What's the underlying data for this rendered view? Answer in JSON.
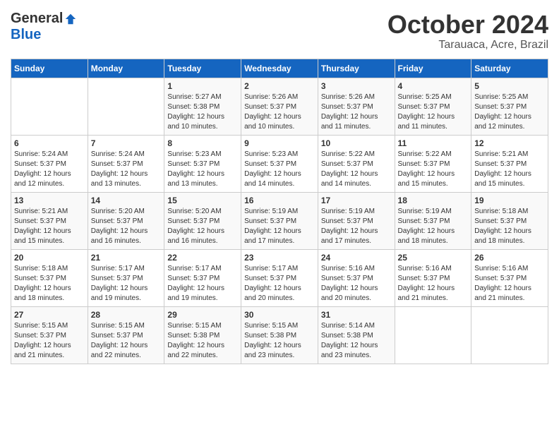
{
  "logo": {
    "general": "General",
    "blue": "Blue"
  },
  "header": {
    "month": "October 2024",
    "location": "Tarauaca, Acre, Brazil"
  },
  "days_of_week": [
    "Sunday",
    "Monday",
    "Tuesday",
    "Wednesday",
    "Thursday",
    "Friday",
    "Saturday"
  ],
  "weeks": [
    [
      {
        "day": "",
        "sunrise": "",
        "sunset": "",
        "daylight": ""
      },
      {
        "day": "",
        "sunrise": "",
        "sunset": "",
        "daylight": ""
      },
      {
        "day": "1",
        "sunrise": "Sunrise: 5:27 AM",
        "sunset": "Sunset: 5:38 PM",
        "daylight": "Daylight: 12 hours and 10 minutes."
      },
      {
        "day": "2",
        "sunrise": "Sunrise: 5:26 AM",
        "sunset": "Sunset: 5:37 PM",
        "daylight": "Daylight: 12 hours and 10 minutes."
      },
      {
        "day": "3",
        "sunrise": "Sunrise: 5:26 AM",
        "sunset": "Sunset: 5:37 PM",
        "daylight": "Daylight: 12 hours and 11 minutes."
      },
      {
        "day": "4",
        "sunrise": "Sunrise: 5:25 AM",
        "sunset": "Sunset: 5:37 PM",
        "daylight": "Daylight: 12 hours and 11 minutes."
      },
      {
        "day": "5",
        "sunrise": "Sunrise: 5:25 AM",
        "sunset": "Sunset: 5:37 PM",
        "daylight": "Daylight: 12 hours and 12 minutes."
      }
    ],
    [
      {
        "day": "6",
        "sunrise": "Sunrise: 5:24 AM",
        "sunset": "Sunset: 5:37 PM",
        "daylight": "Daylight: 12 hours and 12 minutes."
      },
      {
        "day": "7",
        "sunrise": "Sunrise: 5:24 AM",
        "sunset": "Sunset: 5:37 PM",
        "daylight": "Daylight: 12 hours and 13 minutes."
      },
      {
        "day": "8",
        "sunrise": "Sunrise: 5:23 AM",
        "sunset": "Sunset: 5:37 PM",
        "daylight": "Daylight: 12 hours and 13 minutes."
      },
      {
        "day": "9",
        "sunrise": "Sunrise: 5:23 AM",
        "sunset": "Sunset: 5:37 PM",
        "daylight": "Daylight: 12 hours and 14 minutes."
      },
      {
        "day": "10",
        "sunrise": "Sunrise: 5:22 AM",
        "sunset": "Sunset: 5:37 PM",
        "daylight": "Daylight: 12 hours and 14 minutes."
      },
      {
        "day": "11",
        "sunrise": "Sunrise: 5:22 AM",
        "sunset": "Sunset: 5:37 PM",
        "daylight": "Daylight: 12 hours and 15 minutes."
      },
      {
        "day": "12",
        "sunrise": "Sunrise: 5:21 AM",
        "sunset": "Sunset: 5:37 PM",
        "daylight": "Daylight: 12 hours and 15 minutes."
      }
    ],
    [
      {
        "day": "13",
        "sunrise": "Sunrise: 5:21 AM",
        "sunset": "Sunset: 5:37 PM",
        "daylight": "Daylight: 12 hours and 15 minutes."
      },
      {
        "day": "14",
        "sunrise": "Sunrise: 5:20 AM",
        "sunset": "Sunset: 5:37 PM",
        "daylight": "Daylight: 12 hours and 16 minutes."
      },
      {
        "day": "15",
        "sunrise": "Sunrise: 5:20 AM",
        "sunset": "Sunset: 5:37 PM",
        "daylight": "Daylight: 12 hours and 16 minutes."
      },
      {
        "day": "16",
        "sunrise": "Sunrise: 5:19 AM",
        "sunset": "Sunset: 5:37 PM",
        "daylight": "Daylight: 12 hours and 17 minutes."
      },
      {
        "day": "17",
        "sunrise": "Sunrise: 5:19 AM",
        "sunset": "Sunset: 5:37 PM",
        "daylight": "Daylight: 12 hours and 17 minutes."
      },
      {
        "day": "18",
        "sunrise": "Sunrise: 5:19 AM",
        "sunset": "Sunset: 5:37 PM",
        "daylight": "Daylight: 12 hours and 18 minutes."
      },
      {
        "day": "19",
        "sunrise": "Sunrise: 5:18 AM",
        "sunset": "Sunset: 5:37 PM",
        "daylight": "Daylight: 12 hours and 18 minutes."
      }
    ],
    [
      {
        "day": "20",
        "sunrise": "Sunrise: 5:18 AM",
        "sunset": "Sunset: 5:37 PM",
        "daylight": "Daylight: 12 hours and 18 minutes."
      },
      {
        "day": "21",
        "sunrise": "Sunrise: 5:17 AM",
        "sunset": "Sunset: 5:37 PM",
        "daylight": "Daylight: 12 hours and 19 minutes."
      },
      {
        "day": "22",
        "sunrise": "Sunrise: 5:17 AM",
        "sunset": "Sunset: 5:37 PM",
        "daylight": "Daylight: 12 hours and 19 minutes."
      },
      {
        "day": "23",
        "sunrise": "Sunrise: 5:17 AM",
        "sunset": "Sunset: 5:37 PM",
        "daylight": "Daylight: 12 hours and 20 minutes."
      },
      {
        "day": "24",
        "sunrise": "Sunrise: 5:16 AM",
        "sunset": "Sunset: 5:37 PM",
        "daylight": "Daylight: 12 hours and 20 minutes."
      },
      {
        "day": "25",
        "sunrise": "Sunrise: 5:16 AM",
        "sunset": "Sunset: 5:37 PM",
        "daylight": "Daylight: 12 hours and 21 minutes."
      },
      {
        "day": "26",
        "sunrise": "Sunrise: 5:16 AM",
        "sunset": "Sunset: 5:37 PM",
        "daylight": "Daylight: 12 hours and 21 minutes."
      }
    ],
    [
      {
        "day": "27",
        "sunrise": "Sunrise: 5:15 AM",
        "sunset": "Sunset: 5:37 PM",
        "daylight": "Daylight: 12 hours and 21 minutes."
      },
      {
        "day": "28",
        "sunrise": "Sunrise: 5:15 AM",
        "sunset": "Sunset: 5:37 PM",
        "daylight": "Daylight: 12 hours and 22 minutes."
      },
      {
        "day": "29",
        "sunrise": "Sunrise: 5:15 AM",
        "sunset": "Sunset: 5:38 PM",
        "daylight": "Daylight: 12 hours and 22 minutes."
      },
      {
        "day": "30",
        "sunrise": "Sunrise: 5:15 AM",
        "sunset": "Sunset: 5:38 PM",
        "daylight": "Daylight: 12 hours and 23 minutes."
      },
      {
        "day": "31",
        "sunrise": "Sunrise: 5:14 AM",
        "sunset": "Sunset: 5:38 PM",
        "daylight": "Daylight: 12 hours and 23 minutes."
      },
      {
        "day": "",
        "sunrise": "",
        "sunset": "",
        "daylight": ""
      },
      {
        "day": "",
        "sunrise": "",
        "sunset": "",
        "daylight": ""
      }
    ]
  ]
}
